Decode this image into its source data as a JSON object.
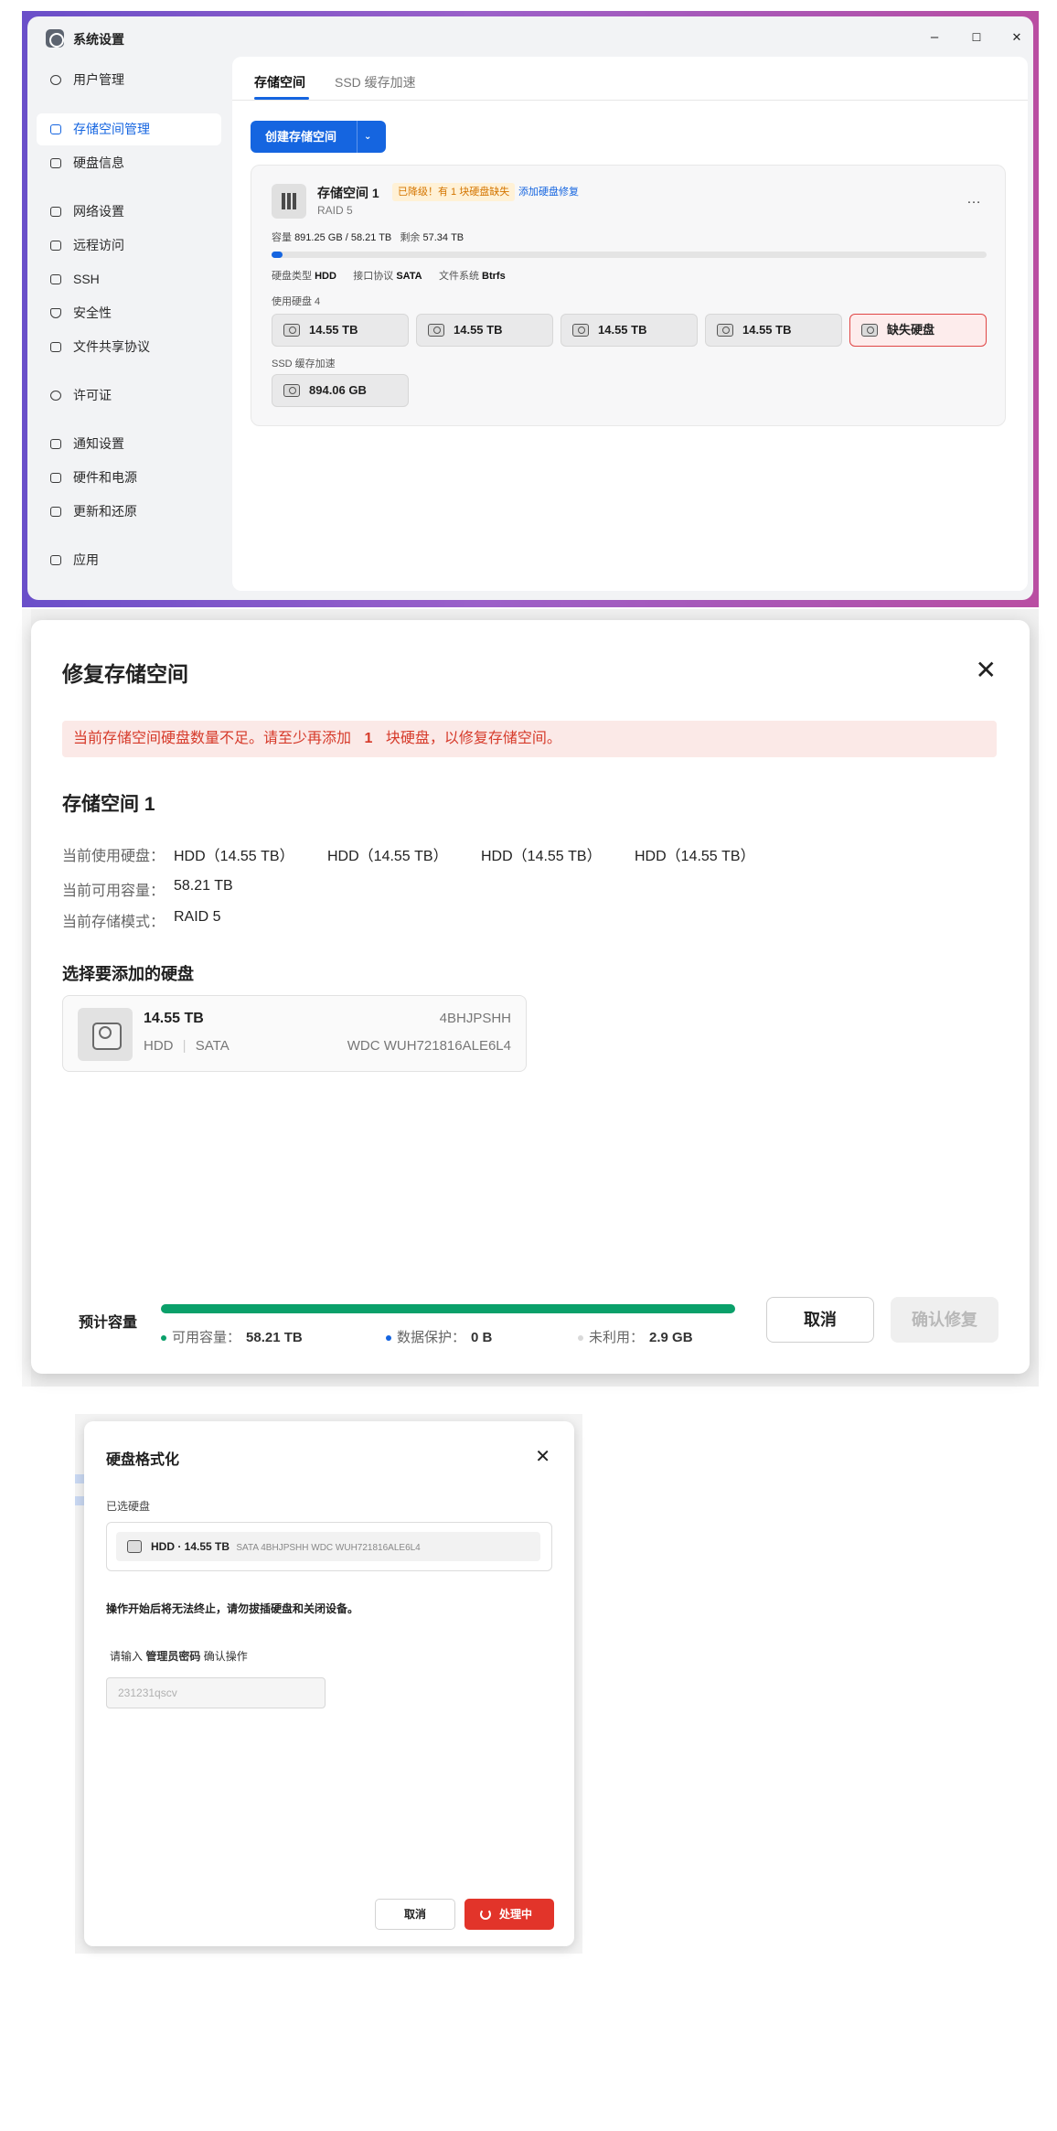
{
  "window": {
    "title": "系统设置",
    "controls": {
      "minimize": "–",
      "maximize": "☐",
      "close": "✕"
    }
  },
  "sidebar": {
    "items": [
      {
        "label": "用户管理",
        "icon": "user-icon"
      },
      {
        "label": "存储空间管理",
        "icon": "storage-icon",
        "active": true
      },
      {
        "label": "硬盘信息",
        "icon": "disk-icon"
      },
      {
        "label": "网络设置",
        "icon": "network-icon"
      },
      {
        "label": "远程访问",
        "icon": "send-icon"
      },
      {
        "label": "SSH",
        "icon": "terminal-icon"
      },
      {
        "label": "安全性",
        "icon": "shield-icon"
      },
      {
        "label": "文件共享协议",
        "icon": "file-icon"
      },
      {
        "label": "许可证",
        "icon": "key-icon"
      },
      {
        "label": "通知设置",
        "icon": "mail-icon"
      },
      {
        "label": "硬件和电源",
        "icon": "hardware-icon"
      },
      {
        "label": "更新和还原",
        "icon": "rocket-icon"
      },
      {
        "label": "应用",
        "icon": "apps-icon"
      }
    ]
  },
  "tabs": [
    {
      "label": "存储空间",
      "active": true
    },
    {
      "label": "SSD 缓存加速",
      "active": false
    }
  ],
  "create_button": {
    "label": "创建存储空间",
    "dropdown": "⌄"
  },
  "pool": {
    "name": "存储空间 1",
    "badge": "已降级！有 1 块硬盘缺失",
    "badge_link": "添加硬盘修复",
    "raid": "RAID 5",
    "more": "…",
    "capacity_label": "容量",
    "capacity_value": "891.25 GB / 58.21 TB",
    "remaining_label": "剩余",
    "remaining_value": "57.34 TB",
    "usage_fraction": 0.015,
    "disk_type_label": "硬盘类型",
    "disk_type": "HDD",
    "interface_label": "接口协议",
    "interface": "SATA",
    "fs_label": "文件系统",
    "fs": "Btrfs",
    "used_disks_label": "使用硬盘 4",
    "disks": [
      "14.55 TB",
      "14.55 TB",
      "14.55 TB",
      "14.55 TB"
    ],
    "missing_disk": "缺失硬盘",
    "ssd_label": "SSD 缓存加速",
    "ssd_value": "894.06 GB"
  },
  "repair_dialog": {
    "title": "修复存储空间",
    "close": "✕",
    "warning_pre": "当前存储空间硬盘数量不足。请至少再添加",
    "warning_count": "1",
    "warning_post": "块硬盘，以修复存储空间。",
    "pool_name": "存储空间 1",
    "current_disks_label": "当前使用硬盘：",
    "current_disks": [
      "HDD（14.55 TB）",
      "HDD（14.55 TB）",
      "HDD（14.55 TB）",
      "HDD（14.55 TB）"
    ],
    "available_label": "当前可用容量：",
    "available_value": "58.21 TB",
    "mode_label": "当前存储模式：",
    "mode_value": "RAID 5",
    "select_title": "选择要添加的硬盘",
    "candidate": {
      "size": "14.55 TB",
      "type": "HDD",
      "sep": "|",
      "interface": "SATA",
      "serial": "4BHJPSHH",
      "model": "WDC WUH721816ALE6L4"
    },
    "estimate_label": "预计容量",
    "estimate_fraction": 1.0,
    "legend": [
      {
        "label": "可用容量：",
        "value": "58.21 TB",
        "color": "#0aa06a"
      },
      {
        "label": "数据保护：",
        "value": "0 B",
        "color": "#1565e0"
      },
      {
        "label": "未利用：",
        "value": "2.9 GB",
        "color": "#d9d9d9"
      }
    ],
    "cancel": "取消",
    "confirm": "确认修复"
  },
  "format_dialog": {
    "title": "硬盘格式化",
    "close": "✕",
    "selected_label": "已选硬盘",
    "selected_main": "HDD · 14.55 TB",
    "selected_sub": "SATA   4BHJPSHH   WDC WUH721816ALE6L4",
    "warning": "操作开始后将无法终止，请勿拔插硬盘和关闭设备。",
    "prompt_pre": "请输入",
    "prompt_bold": "管理员密码",
    "prompt_post": "确认操作",
    "password_value": "231231qscv",
    "cancel": "取消",
    "process": "处理中"
  },
  "colors": {
    "accent": "#1565e0",
    "danger": "#e2342a",
    "success": "#0aa06a",
    "warning": "#d47500"
  }
}
